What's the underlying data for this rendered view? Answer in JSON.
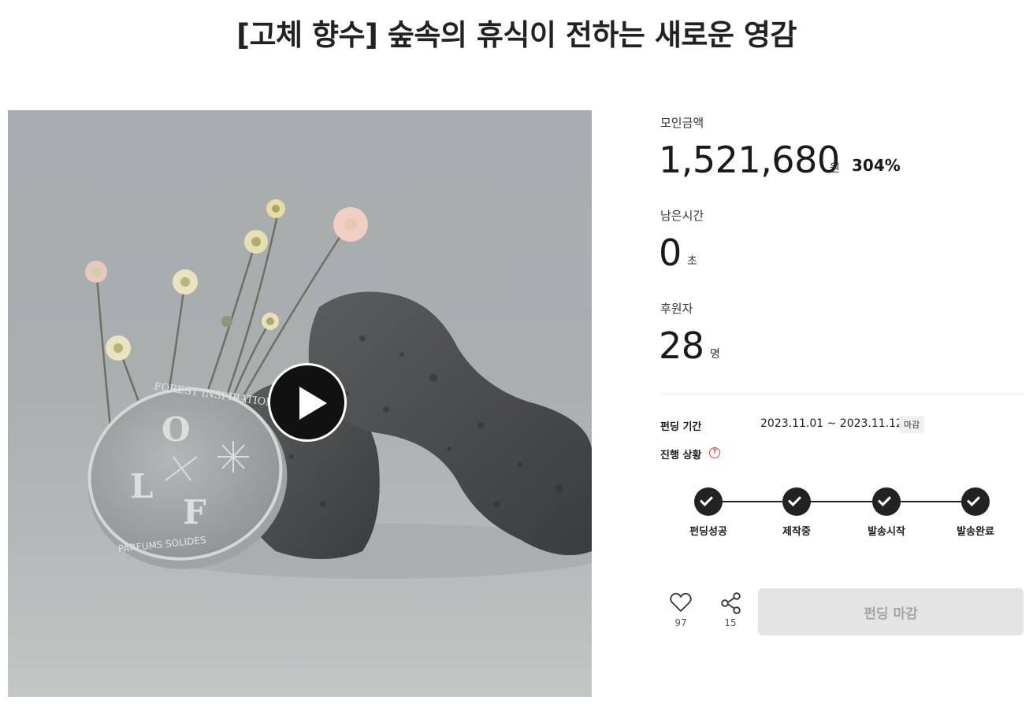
{
  "project": {
    "title": "[고체 향수] 숲속의 휴식이 전하는 새로운 영감"
  },
  "media": {
    "tin_top_text": "FOREST INSPIRATION",
    "tin_bottom_text": "PARFUMS SOLIDES",
    "tin_letter_1": "O",
    "tin_letter_2": "L",
    "tin_letter_3": "F"
  },
  "stats": {
    "amount_label": "모인금액",
    "amount_value": "1,521,680",
    "amount_unit": "원",
    "percent": "304%",
    "time_label": "남은시간",
    "time_value": "0",
    "time_unit": "초",
    "backers_label": "후원자",
    "backers_value": "28",
    "backers_unit": "명"
  },
  "info": {
    "period_label": "펀딩 기간",
    "period_value": "2023.11.01 ~ 2023.11.12",
    "period_badge": "마감",
    "status_label": "진행 상황",
    "help_glyph": "?"
  },
  "progress": {
    "steps": [
      {
        "label": "펀딩성공",
        "done": true
      },
      {
        "label": "제작중",
        "done": true
      },
      {
        "label": "발송시작",
        "done": true
      },
      {
        "label": "발송완료",
        "done": true
      }
    ]
  },
  "actions": {
    "like_count": "97",
    "share_count": "15",
    "main_button": "펀딩 마감"
  },
  "colors": {
    "accent_dark": "#222222",
    "help_red": "#e0433c",
    "disabled_button_bg": "#e4e4e4",
    "disabled_button_text": "#a5a5a5"
  }
}
